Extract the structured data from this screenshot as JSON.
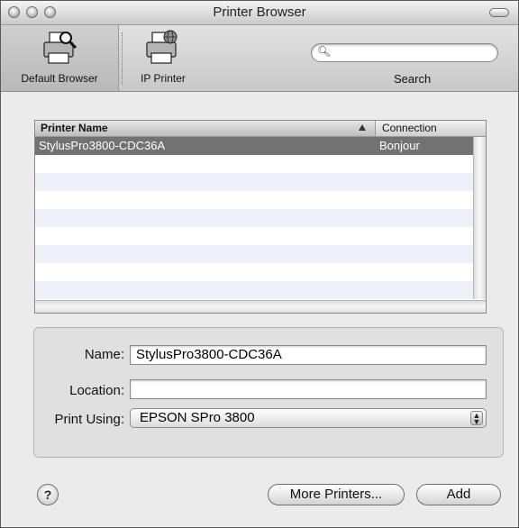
{
  "window": {
    "title": "Printer Browser"
  },
  "toolbar": {
    "default_browser_label": "Default Browser",
    "ip_printer_label": "IP Printer",
    "search_label": "Search",
    "search_value": ""
  },
  "printer_list": {
    "columns": [
      "Printer Name",
      "Connection"
    ],
    "rows": [
      {
        "name": "StylusPro3800-CDC36A",
        "connection": "Bonjour"
      }
    ]
  },
  "details": {
    "name_label": "Name:",
    "name_value": "StylusPro3800-CDC36A",
    "location_label": "Location:",
    "location_value": "",
    "print_using_label": "Print Using:",
    "print_using_value": "EPSON SPro 3800"
  },
  "buttons": {
    "help": "?",
    "more_printers": "More Printers...",
    "add": "Add"
  }
}
